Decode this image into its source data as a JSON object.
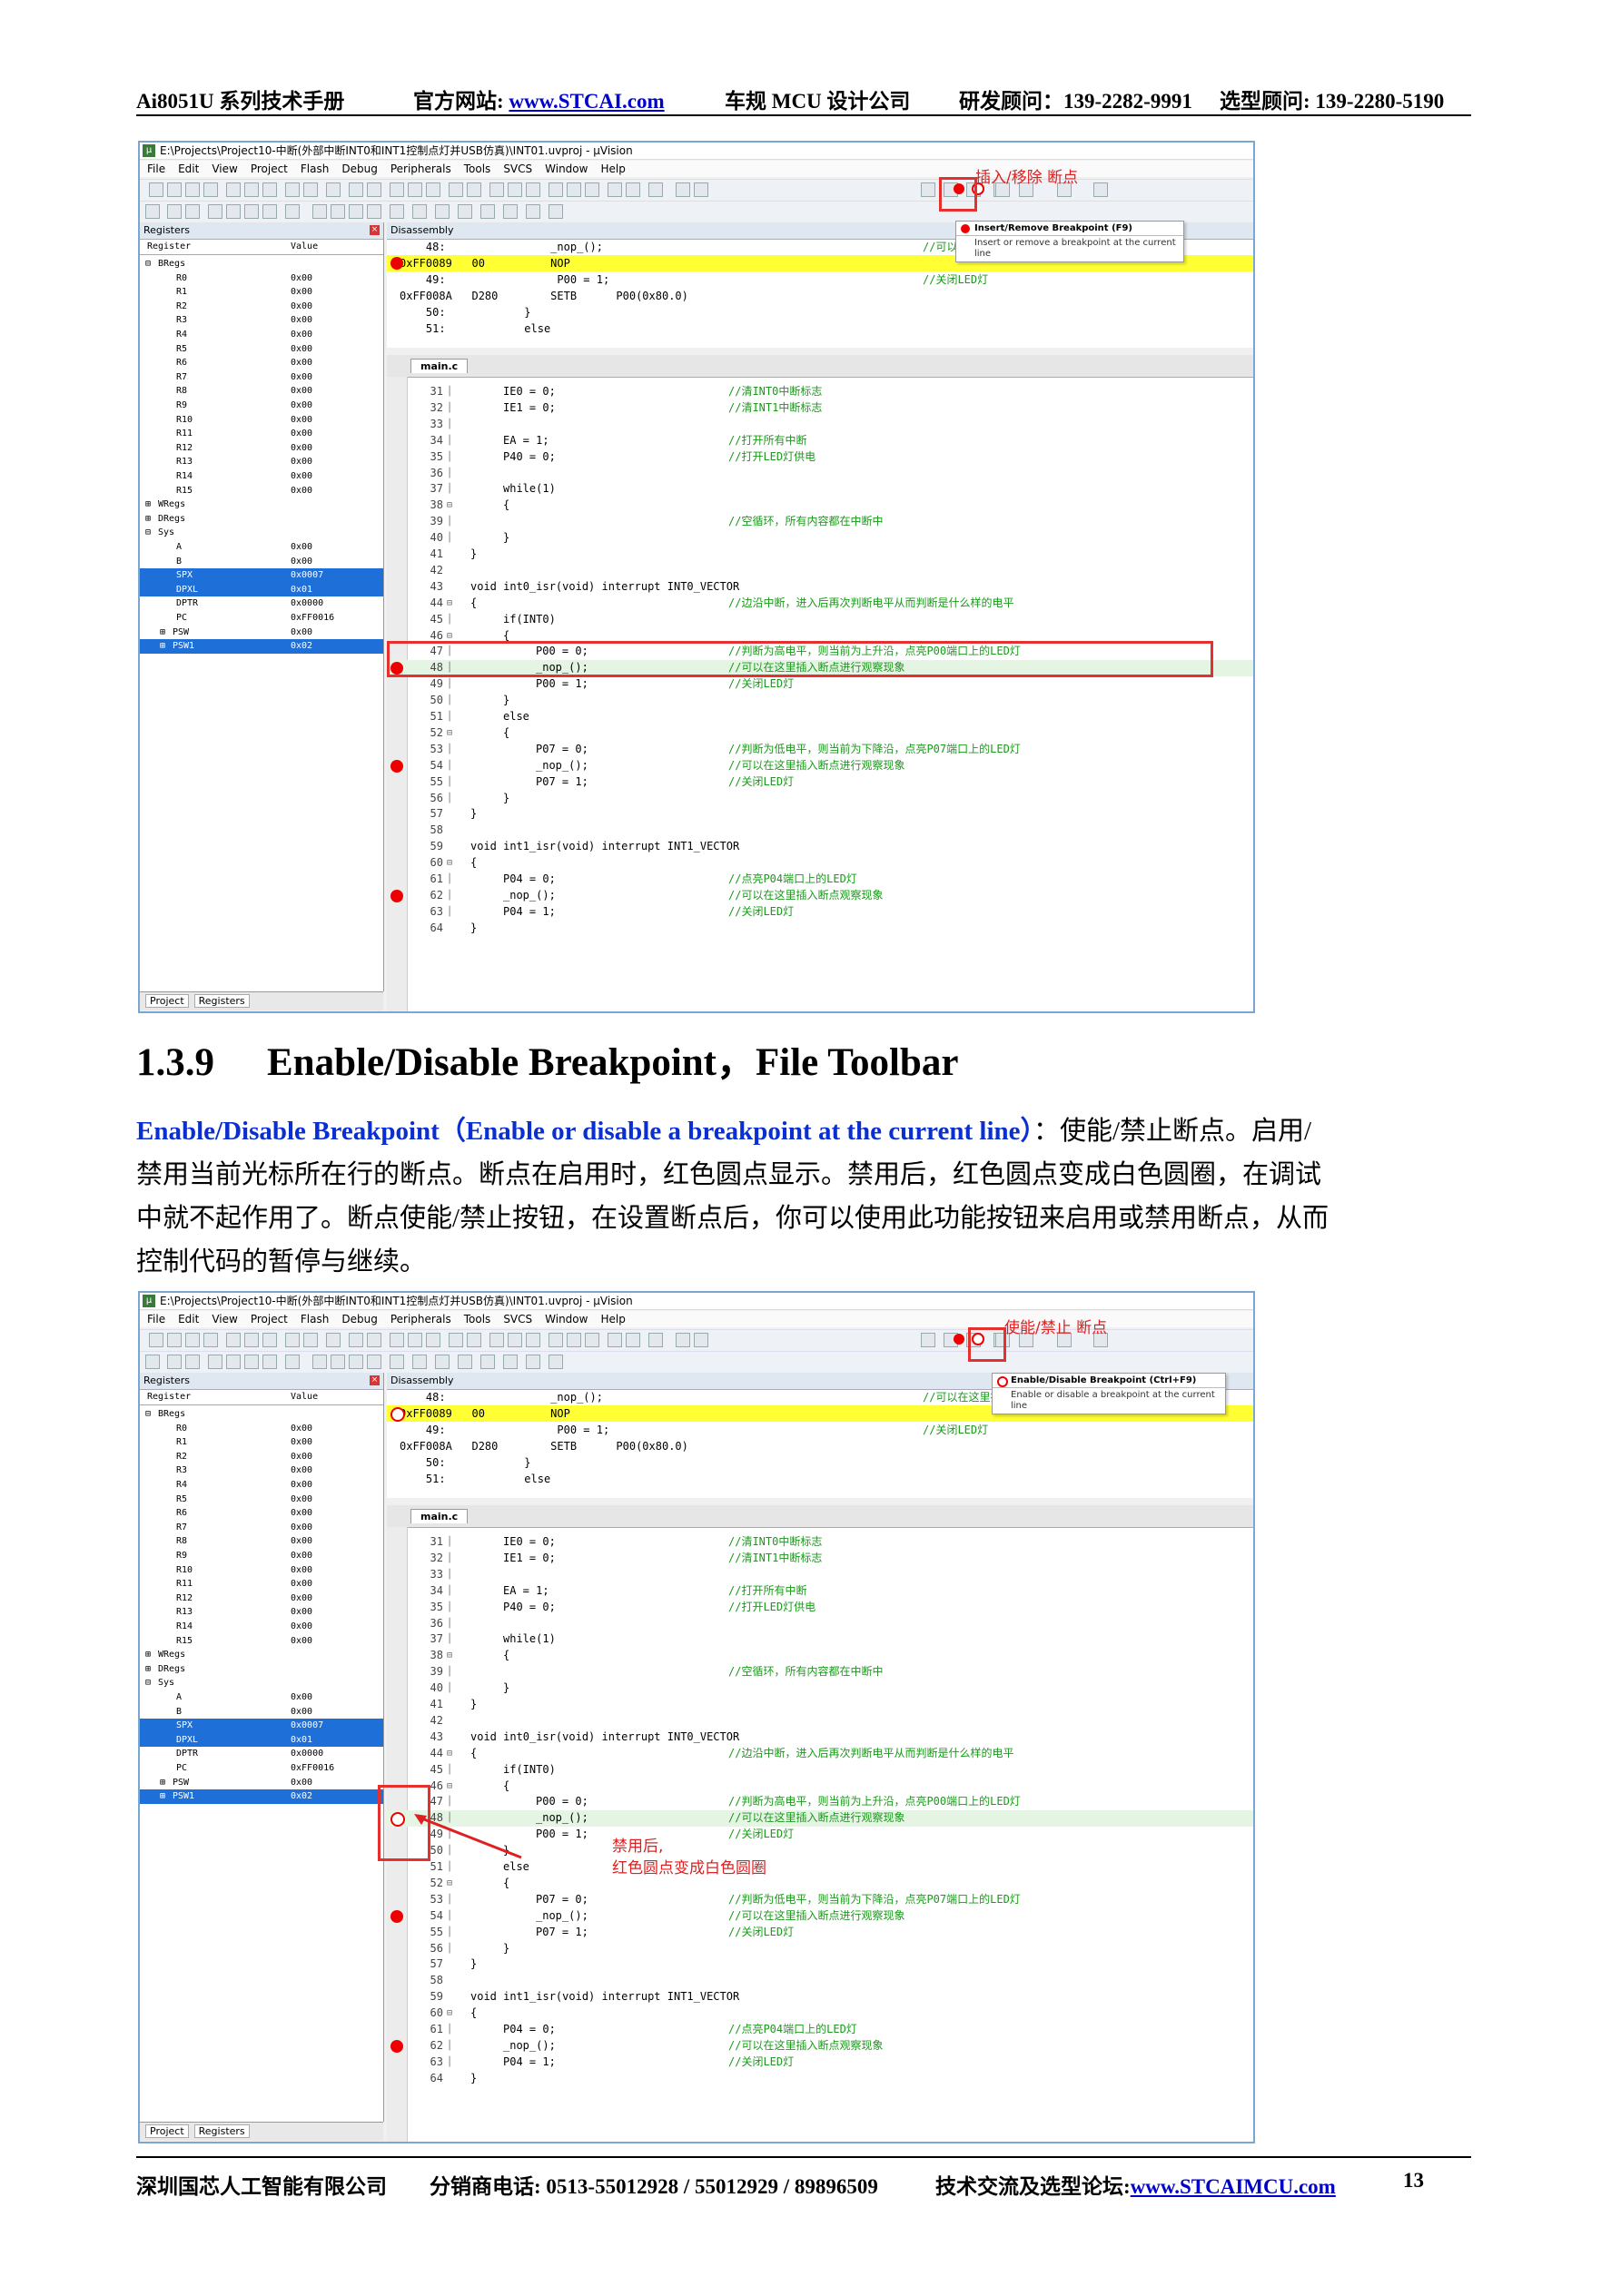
{
  "header": {
    "manual": "Ai8051U 系列技术手册",
    "site_label": "官方网站: ",
    "site_url": "www.STCAI.com",
    "company_type": "车规 MCU 设计公司",
    "rd_consultant": "研发顾问：139-2282-9991",
    "sel_consultant": "选型顾问: 139-2280-5190"
  },
  "footer": {
    "company": "深圳国芯人工智能有限公司",
    "phone": "分销商电话: 0513-55012928 / 55012929 / 89896509",
    "forum_label": "技术交流及选型论坛:",
    "forum_url": "www.STCAIMCU.com",
    "page_number": "13"
  },
  "section": {
    "number": "1.3.9",
    "title": "Enable/Disable Breakpoint，File Toolbar",
    "para_lead": "Enable/Disable Breakpoint（Enable or disable a breakpoint at the current line）",
    "para_lines": [
      "：使能/禁止断点。启用/",
      "禁用当前光标所在行的断点。断点在启用时，红色圆点显示。禁用后，红色圆点变成白色圆圈，在调试",
      "中就不起作用了。断点使能/禁止按钮，在设置断点后，你可以使用此功能按钮来启用或禁用断点，从而",
      "控制代码的暂停与继续。"
    ]
  },
  "ide": {
    "window_title": "E:\\Projects\\Project10-中断(外部中断INT0和INT1控制点灯并USB仿真)\\INT01.uvproj - µVision",
    "menu": [
      "File",
      "Edit",
      "View",
      "Project",
      "Flash",
      "Debug",
      "Peripherals",
      "Tools",
      "SVCS",
      "Window",
      "Help"
    ],
    "registers_title": "Registers",
    "disassembly_title": "Disassembly",
    "col_register": "Register",
    "col_value": "Value",
    "source_tab": "main.c",
    "tab_project": "Project",
    "tab_registers": "Registers",
    "registers": [
      {
        "name": "BRegs",
        "value": "",
        "indent": 0,
        "mark": "⊟"
      },
      {
        "name": "R0",
        "value": "0x00",
        "indent": 2
      },
      {
        "name": "R1",
        "value": "0x00",
        "indent": 2
      },
      {
        "name": "R2",
        "value": "0x00",
        "indent": 2
      },
      {
        "name": "R3",
        "value": "0x00",
        "indent": 2
      },
      {
        "name": "R4",
        "value": "0x00",
        "indent": 2
      },
      {
        "name": "R5",
        "value": "0x00",
        "indent": 2
      },
      {
        "name": "R6",
        "value": "0x00",
        "indent": 2
      },
      {
        "name": "R7",
        "value": "0x00",
        "indent": 2
      },
      {
        "name": "R8",
        "value": "0x00",
        "indent": 2
      },
      {
        "name": "R9",
        "value": "0x00",
        "indent": 2
      },
      {
        "name": "R10",
        "value": "0x00",
        "indent": 2
      },
      {
        "name": "R11",
        "value": "0x00",
        "indent": 2
      },
      {
        "name": "R12",
        "value": "0x00",
        "indent": 2
      },
      {
        "name": "R13",
        "value": "0x00",
        "indent": 2
      },
      {
        "name": "R14",
        "value": "0x00",
        "indent": 2
      },
      {
        "name": "R15",
        "value": "0x00",
        "indent": 2
      },
      {
        "name": "WRegs",
        "value": "",
        "indent": 0,
        "mark": "⊞"
      },
      {
        "name": "DRegs",
        "value": "",
        "indent": 0,
        "mark": "⊞"
      },
      {
        "name": "Sys",
        "value": "",
        "indent": 0,
        "mark": "⊟"
      },
      {
        "name": "A",
        "value": "0x00",
        "indent": 2
      },
      {
        "name": "B",
        "value": "0x00",
        "indent": 2
      },
      {
        "name": "SPX",
        "value": "0x0007",
        "indent": 2,
        "sel": true
      },
      {
        "name": "DPXL",
        "value": "0x01",
        "indent": 2,
        "sel": true
      },
      {
        "name": "DPTR",
        "value": "0x0000",
        "indent": 2
      },
      {
        "name": "PC",
        "value": "0xFF0016",
        "indent": 2
      },
      {
        "name": "PSW",
        "value": "0x00",
        "indent": 1,
        "mark": "⊞"
      },
      {
        "name": "PSW1",
        "value": "0x02",
        "indent": 1,
        "mark": "⊞",
        "sel": true
      }
    ],
    "disassembly": [
      {
        "text": "    48:                _nop_();",
        "cmt": "//可以在这里插入断点进行观察现象"
      },
      {
        "text": "0xFF0089   00          NOP",
        "cmt": "",
        "cur": true
      },
      {
        "text": "    49:                 P00 = 1;",
        "cmt": "//关闭LED灯"
      },
      {
        "text": "0xFF008A   D280        SETB      P00(0x80.0)",
        "cmt": ""
      },
      {
        "text": "    50:            }",
        "cmt": ""
      },
      {
        "text": "    51:            else",
        "cmt": ""
      }
    ],
    "source": [
      {
        "n": "31",
        "code": "IE0 = 0;",
        "cmt": "//清INT0中断标志",
        "ind": 1
      },
      {
        "n": "32",
        "code": "IE1 = 0;",
        "cmt": "//清INT1中断标志",
        "ind": 1
      },
      {
        "n": "33",
        "code": "",
        "cmt": "",
        "ind": 1
      },
      {
        "n": "34",
        "code": "EA = 1;",
        "cmt": "//打开所有中断",
        "ind": 1
      },
      {
        "n": "35",
        "code": "P40 = 0;",
        "cmt": "//打开LED灯供电",
        "ind": 1
      },
      {
        "n": "36",
        "code": "",
        "cmt": "",
        "ind": 1
      },
      {
        "n": "37",
        "code": "while(1)",
        "cmt": "",
        "ind": 1
      },
      {
        "n": "38",
        "code": "{",
        "cmt": "",
        "ind": 1,
        "fold": "⊟"
      },
      {
        "n": "39",
        "code": "",
        "cmt": "//空循环，所有内容都在中断中",
        "ind": 1
      },
      {
        "n": "40",
        "code": "}",
        "cmt": "",
        "ind": 1
      },
      {
        "n": "41",
        "code": "}",
        "cmt": "",
        "ind": 0
      },
      {
        "n": "42",
        "code": "",
        "cmt": "",
        "ind": 0
      },
      {
        "n": "43",
        "code": "void int0_isr(void) interrupt INT0_VECTOR",
        "cmt": "",
        "ind": 0
      },
      {
        "n": "44",
        "code": "{",
        "cmt": "//边沿中断，进入后再次判断电平从而判断是什么样的电平",
        "ind": 0,
        "fold": "⊟"
      },
      {
        "n": "45",
        "code": "if(INT0)",
        "cmt": "",
        "ind": 1
      },
      {
        "n": "46",
        "code": "{",
        "cmt": "",
        "ind": 1,
        "fold": "⊟"
      },
      {
        "n": "47",
        "code": "P00 = 0;",
        "cmt": "//判断为高电平，则当前为上升沿，点亮P00端口上的LED灯",
        "ind": 2
      },
      {
        "n": "48",
        "code": "_nop_();",
        "cmt": "//可以在这里插入断点进行观察现象",
        "ind": 2,
        "hl": true
      },
      {
        "n": "49",
        "code": "P00 = 1;",
        "cmt": "//关闭LED灯",
        "ind": 2
      },
      {
        "n": "50",
        "code": "}",
        "cmt": "",
        "ind": 1
      },
      {
        "n": "51",
        "code": "else",
        "cmt": "",
        "ind": 1
      },
      {
        "n": "52",
        "code": "{",
        "cmt": "",
        "ind": 1,
        "fold": "⊟"
      },
      {
        "n": "53",
        "code": "P07 = 0;",
        "cmt": "//判断为低电平，则当前为下降沿，点亮P07端口上的LED灯",
        "ind": 2
      },
      {
        "n": "54",
        "code": "_nop_();",
        "cmt": "//可以在这里插入断点进行观察现象",
        "ind": 2,
        "bp": true
      },
      {
        "n": "55",
        "code": "P07 = 1;",
        "cmt": "//关闭LED灯",
        "ind": 2
      },
      {
        "n": "56",
        "code": "}",
        "cmt": "",
        "ind": 1
      },
      {
        "n": "57",
        "code": "}",
        "cmt": "",
        "ind": 0
      },
      {
        "n": "58",
        "code": "",
        "cmt": "",
        "ind": 0
      },
      {
        "n": "59",
        "code": "void int1_isr(void) interrupt INT1_VECTOR",
        "cmt": "",
        "ind": 0
      },
      {
        "n": "60",
        "code": "{",
        "cmt": "",
        "ind": 0,
        "fold": "⊟"
      },
      {
        "n": "61",
        "code": "P04 = 0;",
        "cmt": "//点亮P04端口上的LED灯",
        "ind": 1
      },
      {
        "n": "62",
        "code": "_nop_();",
        "cmt": "//可以在这里插入断点观察现象",
        "ind": 1,
        "bp": true
      },
      {
        "n": "63",
        "code": "P04 = 1;",
        "cmt": "//关闭LED灯",
        "ind": 1
      },
      {
        "n": "64",
        "code": "}",
        "cmt": "",
        "ind": 0
      }
    ]
  },
  "shot1": {
    "callout": "插入/移除 断点",
    "tooltip_title": "Insert/Remove Breakpoint (F9)",
    "tooltip_desc": "Insert or remove a breakpoint at the current line"
  },
  "shot2": {
    "callout": "使能/禁止 断点",
    "tooltip_title": "Enable/Disable Breakpoint (Ctrl+F9)",
    "tooltip_desc": "Enable or disable a breakpoint at the current line",
    "annotation_1": "禁用后,",
    "annotation_2": "红色圆点变成白色圆圈"
  },
  "colors": {
    "accent_red": "#e53030",
    "link_blue": "#0000cc",
    "comment_green": "#1a9a1a",
    "selection_blue": "#1f6fd8",
    "current_line_yellow": "#ffff33"
  }
}
